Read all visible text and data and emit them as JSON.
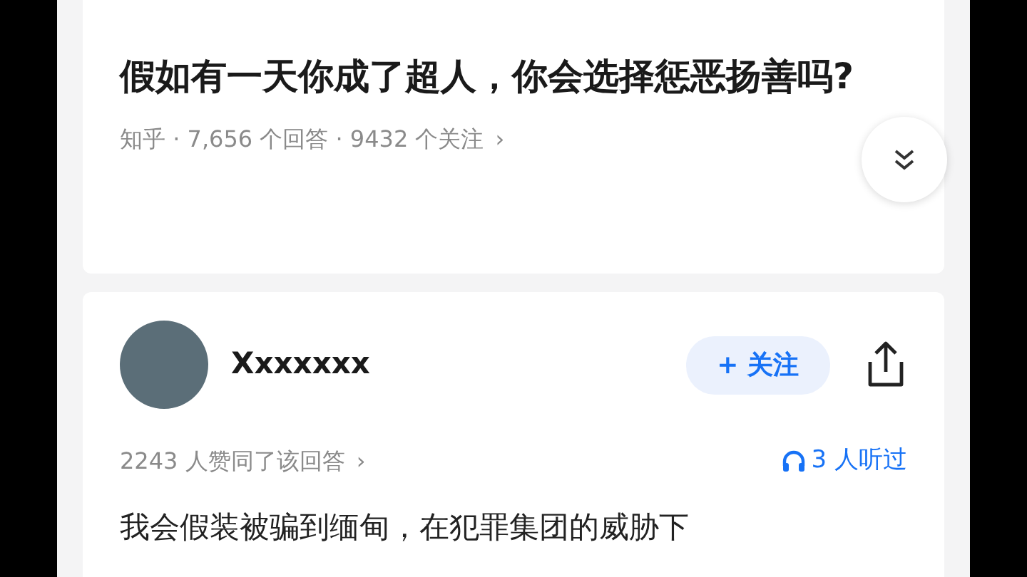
{
  "question": {
    "title": "假如有一天你成了超人，你会选择惩恶扬善吗?",
    "meta": "知乎 · 7,656 个回答 · 9432 个关注",
    "meta_arrow": "›"
  },
  "answer": {
    "author": "Xxxxxxx",
    "follow_button": {
      "icon": "+",
      "label": "关注"
    },
    "upvotes": "2243 人赞同了该回答",
    "upvotes_arrow": "›",
    "listeners": "3 人听过",
    "text": "我会假装被骗到缅甸，在犯罪集团的威胁下"
  }
}
